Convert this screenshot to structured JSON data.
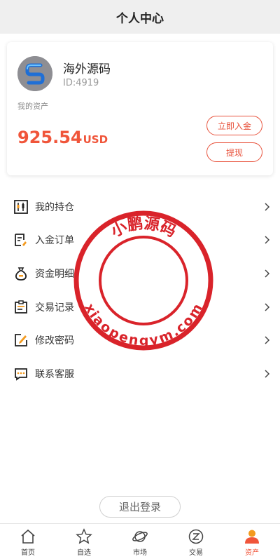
{
  "header": {
    "title": "个人中心"
  },
  "profile": {
    "name": "海外源码",
    "id_text": "ID:4919",
    "assets_label": "我的资产",
    "balance_amount": "925.54",
    "balance_unit": "USD",
    "deposit_label": "立即入金",
    "withdraw_label": "提现"
  },
  "menu": {
    "items": [
      {
        "label": "我的持仓",
        "icon": "holdings-chart-icon"
      },
      {
        "label": "入金订单",
        "icon": "deposit-order-icon"
      },
      {
        "label": "资金明细",
        "icon": "money-bag-icon"
      },
      {
        "label": "交易记录",
        "icon": "trade-record-icon"
      },
      {
        "label": "修改密码",
        "icon": "edit-password-icon"
      },
      {
        "label": "联系客服",
        "icon": "chat-support-icon"
      }
    ]
  },
  "watermark": {
    "top_text": "小鹏源码",
    "bottom_text": "xiaopengym.com"
  },
  "logout_label": "退出登录",
  "tabbar": {
    "tabs": [
      {
        "label": "首页",
        "icon": "home-icon"
      },
      {
        "label": "自选",
        "icon": "star-icon"
      },
      {
        "label": "市场",
        "icon": "planet-icon"
      },
      {
        "label": "交易",
        "icon": "trade-icon"
      },
      {
        "label": "资产",
        "icon": "user-assets-icon",
        "active": true
      }
    ]
  },
  "colors": {
    "accent": "#f0553a",
    "stamp_red": "#d9232a"
  }
}
